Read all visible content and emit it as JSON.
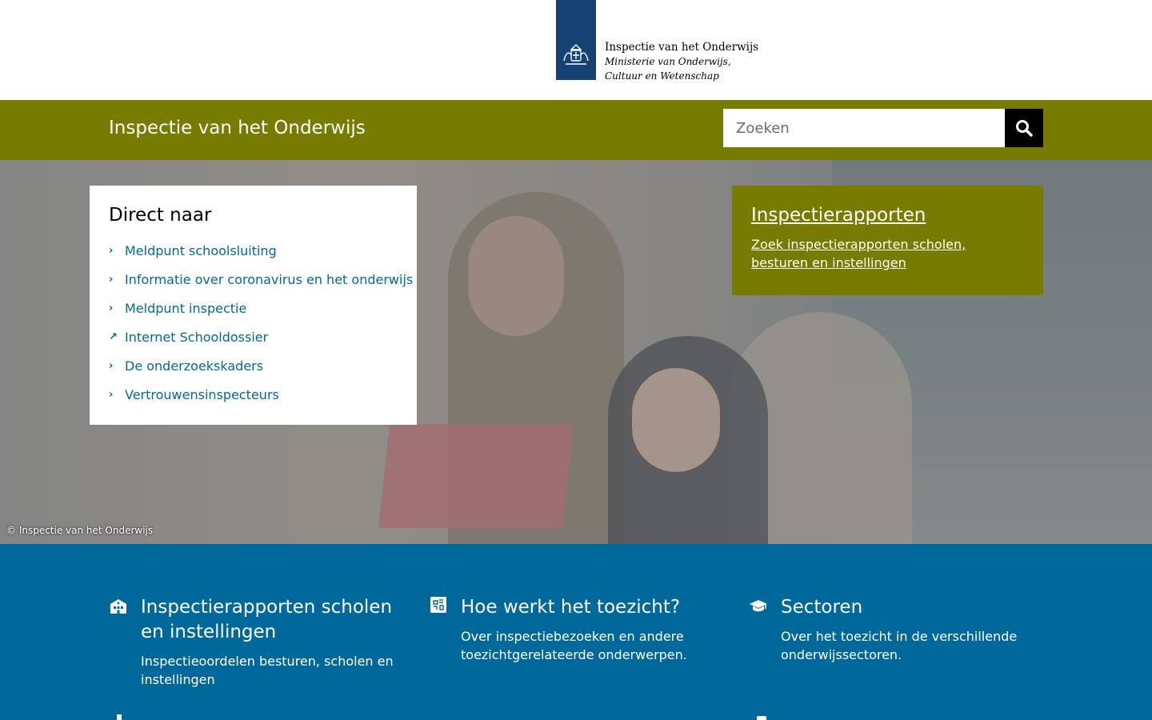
{
  "logo": {
    "line1": "Inspectie van het Onderwijs",
    "line2": "Ministerie van Onderwijs, Cultuur en Wetenschap",
    "block_color": "#154273"
  },
  "header": {
    "site_title": "Inspectie van het Onderwijs",
    "search_placeholder": "Zoeken",
    "search_icon": "search-icon",
    "bg_color": "#777b00"
  },
  "hero": {
    "photo_credit": "© Inspectie van het Onderwijs",
    "direct": {
      "title": "Direct naar",
      "items": [
        {
          "label": "Meldpunt schoolsluiting",
          "icon": "chevron-right-icon"
        },
        {
          "label": "Informatie over coronavirus en het onderwijs",
          "icon": "chevron-right-icon"
        },
        {
          "label": "Meldpunt inspectie",
          "icon": "chevron-right-icon"
        },
        {
          "label": "Internet Schooldossier",
          "icon": "external-link-icon"
        },
        {
          "label": "De onderzoekskaders",
          "icon": "chevron-right-icon"
        },
        {
          "label": "Vertrouwensinspecteurs",
          "icon": "chevron-right-icon"
        }
      ]
    },
    "rapport": {
      "title": "Inspectierapporten",
      "link": "Zoek inspectierapporten scholen, besturen en instellingen"
    }
  },
  "tiles": [
    {
      "title": "Inspectierapporten scholen en instellingen",
      "desc": "Inspectieoordelen besturen, scholen en instellingen",
      "icon": "school-building-icon"
    },
    {
      "title": "Hoe werkt het toezicht?",
      "desc": "Over inspectiebezoeken en andere toezichtgerelateerde onderwerpen.",
      "icon": "puzzle-icon"
    },
    {
      "title": "Sectoren",
      "desc": "Over het toezicht in de verschillende onderwijssectoren.",
      "icon": "graduation-cap-icon"
    }
  ],
  "colors": {
    "link_blue": "#01689b",
    "band_blue": "#01689b",
    "olive": "#777b00"
  }
}
